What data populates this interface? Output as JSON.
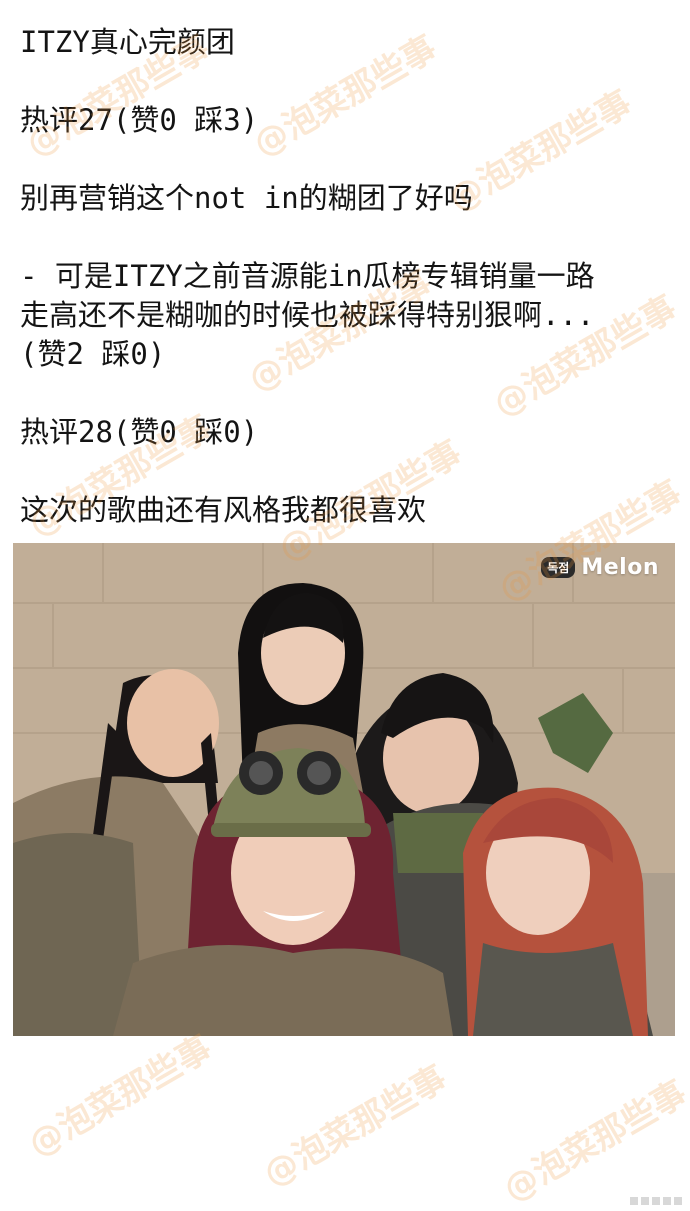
{
  "post": {
    "lines": [
      "ITZY真心完颜团",
      "热评27(赞0 踩3)",
      "别再营销这个not in的糊团了好吗",
      "- 可是ITZY之前音源能in瓜榜专辑销量一路",
      "走高还不是糊咖的时候也被踩得特别狠啊...",
      "(赞2 踩0)",
      "热评28(赞0 踩0)",
      "这次的歌曲还有风格我都很喜欢"
    ]
  },
  "photo": {
    "badge_tag": "독점",
    "badge_logo": "Melon"
  },
  "watermark": "@泡菜那些事"
}
